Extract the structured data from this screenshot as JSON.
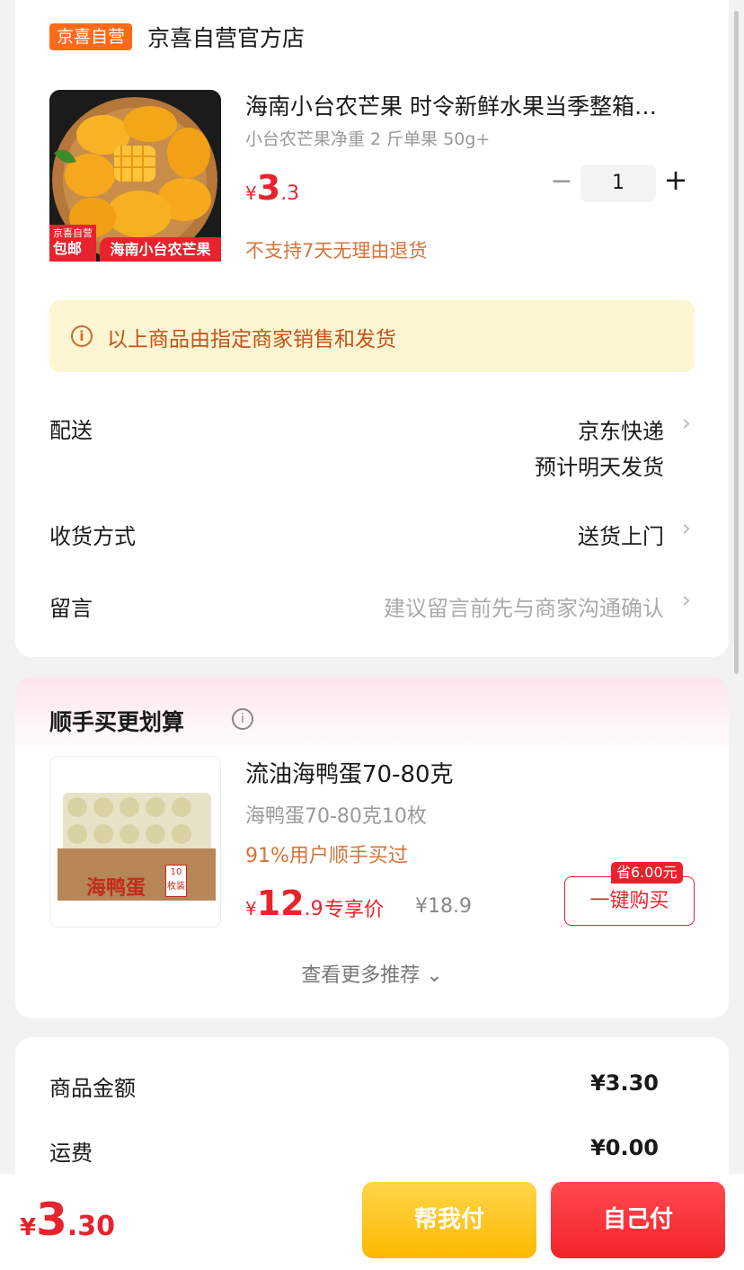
{
  "store": {
    "badge": "京喜自营",
    "name": "京喜自营官方店"
  },
  "product": {
    "title": "海南小台农芒果 时令新鲜水果当季整箱…",
    "spec": "小台农芒果净重 2 斤单果 50g+",
    "price_yen": "¥",
    "price_int": "3",
    "price_dec": ".3",
    "quantity": "1",
    "minus": "−",
    "plus": "+",
    "no_return": "不支持7天无理由退货",
    "img_tag_top": "京喜自营",
    "img_tag_bottom": "包邮",
    "img_banner": "海南小台农芒果"
  },
  "notice": {
    "icon": "i",
    "text": "以上商品由指定商家销售和发货"
  },
  "rows": {
    "delivery_label": "配送",
    "delivery_value": "京东快递",
    "delivery_sub": "预计明天发货",
    "method_label": "收货方式",
    "method_value": "送货上门",
    "message_label": "留言",
    "message_placeholder": "建议留言前先与商家沟通确认",
    "chevron": "›"
  },
  "recommend": {
    "title": "顺手买更划算",
    "info_icon": "i",
    "item_title": "流油海鸭蛋70-80克",
    "item_spec": "海鸭蛋70-80克10枚",
    "item_pct": "91%用户顺手买过",
    "price_yen": "¥",
    "price_int": "12",
    "price_dec": ".9",
    "exclusive": "专享价",
    "orig_price": "¥18.9",
    "save_tag": "省6.00元",
    "buy_button": "一键购买",
    "more": "查看更多推荐",
    "more_icon": "⌄",
    "img_brand": "海鸭蛋",
    "img_count": "10",
    "img_count_unit": "枚装"
  },
  "summary": {
    "goods_label": "商品金额",
    "goods_value": "¥3.30",
    "freight_label": "运费",
    "freight_value": "¥0.00"
  },
  "bottom": {
    "yen": "¥",
    "total_int": "3",
    "total_dec": ".30",
    "help_pay": "帮我付",
    "self_pay": "自己付"
  },
  "colors": {
    "accent": "#e8232d",
    "orange": "#ff6a1a",
    "notice_bg": "#fdf6d2",
    "help_btn": "#fcb900"
  }
}
